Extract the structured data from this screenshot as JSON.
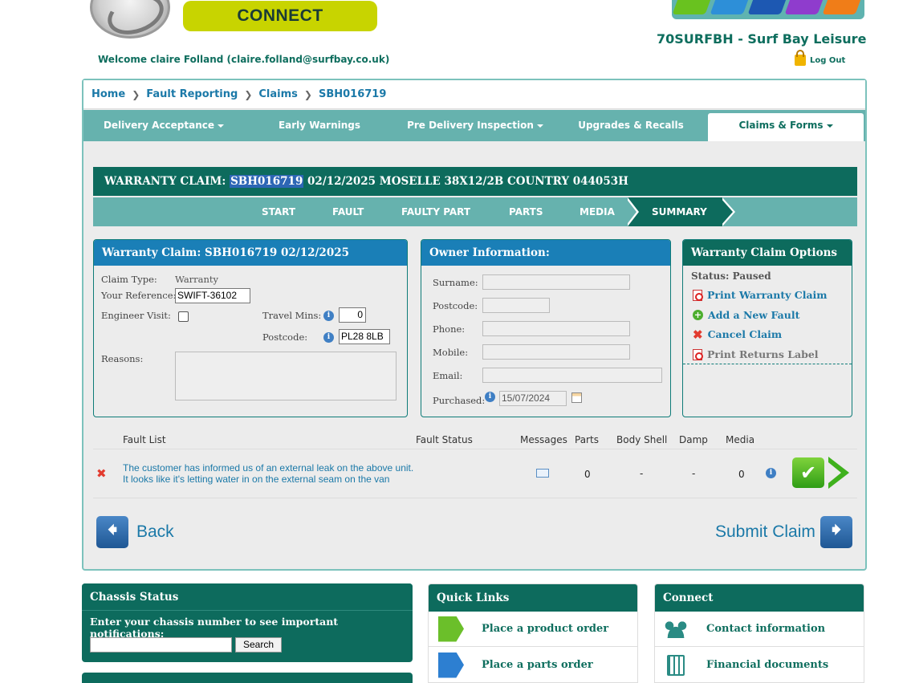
{
  "header": {
    "connect_label": "CONNECT",
    "dealer_name": "70SURFBH - Surf Bay Leisure",
    "logout_label": "Log Out",
    "welcome": "Welcome claire Folland (claire.folland@surfbay.co.uk)"
  },
  "breadcrumb": [
    "Home",
    "Fault Reporting",
    "Claims",
    "SBH016719"
  ],
  "nav": [
    {
      "label": "Delivery Acceptance",
      "dropdown": true
    },
    {
      "label": "Early Warnings",
      "dropdown": false
    },
    {
      "label": "Pre Delivery Inspection",
      "dropdown": true
    },
    {
      "label": "Upgrades & Recalls",
      "dropdown": false
    },
    {
      "label": "Claims & Forms",
      "dropdown": true
    }
  ],
  "claim_header": {
    "prefix": "WARRANTY CLAIM: ",
    "claim_id": "SBH016719",
    "rest": " 02/12/2025 MOSELLE 38X12/2B COUNTRY 044053H"
  },
  "steps": [
    "START",
    "FAULT",
    "FAULTY PART",
    "PARTS",
    "MEDIA",
    "SUMMARY"
  ],
  "claim_box": {
    "title": "Warranty Claim: SBH016719 02/12/2025",
    "claim_type_label": "Claim Type:",
    "claim_type_value": "Warranty",
    "reference_label": "Your Reference:",
    "reference_value": "SWIFT-36102",
    "engineer_label": "Engineer Visit:",
    "travel_label": "Travel Mins:",
    "travel_value": "0",
    "postcode_label": "Postcode:",
    "postcode_value": "PL28 8LB",
    "reasons_label": "Reasons:"
  },
  "owner_box": {
    "title": "Owner Information:",
    "surname_label": "Surname:",
    "postcode_label": "Postcode:",
    "phone_label": "Phone:",
    "mobile_label": "Mobile:",
    "email_label": "Email:",
    "purchased_label": "Purchased:",
    "purchased_value": "15/07/2024"
  },
  "options_box": {
    "title": "Warranty Claim Options",
    "status": "Status: Paused",
    "print_claim": "Print Warranty Claim",
    "add_fault": "Add a New Fault",
    "cancel_claim": "Cancel Claim",
    "print_returns": "Print Returns Label"
  },
  "fault_table": {
    "headers": [
      "Fault List",
      "Fault Status",
      "Messages",
      "Parts",
      "Body Shell",
      "Damp",
      "Media"
    ],
    "rows": [
      {
        "line1": "The customer has informed us of an external leak on the above unit.",
        "line2": "It looks like it's letting water in on the external seam on the van",
        "parts": "0",
        "body_shell": "-",
        "damp": "-",
        "media": "0"
      }
    ]
  },
  "actions": {
    "back": "Back",
    "submit": "Submit Claim"
  },
  "chassis": {
    "title": "Chassis Status",
    "prompt": "Enter your chassis number to see important notifications:",
    "search": "Search"
  },
  "quick_links": {
    "title": "Quick Links",
    "items": [
      "Place a product order",
      "Place a parts order"
    ]
  },
  "connect_box": {
    "title": "Connect",
    "items": [
      "Contact information",
      "Financial documents"
    ]
  },
  "colors": {
    "primary_teal": "#0d6b5d",
    "nav_teal": "#66b2ae",
    "link_blue": "#1b79a8",
    "owner_blue": "#1a7fb7",
    "badge_green": "#c8d400"
  }
}
